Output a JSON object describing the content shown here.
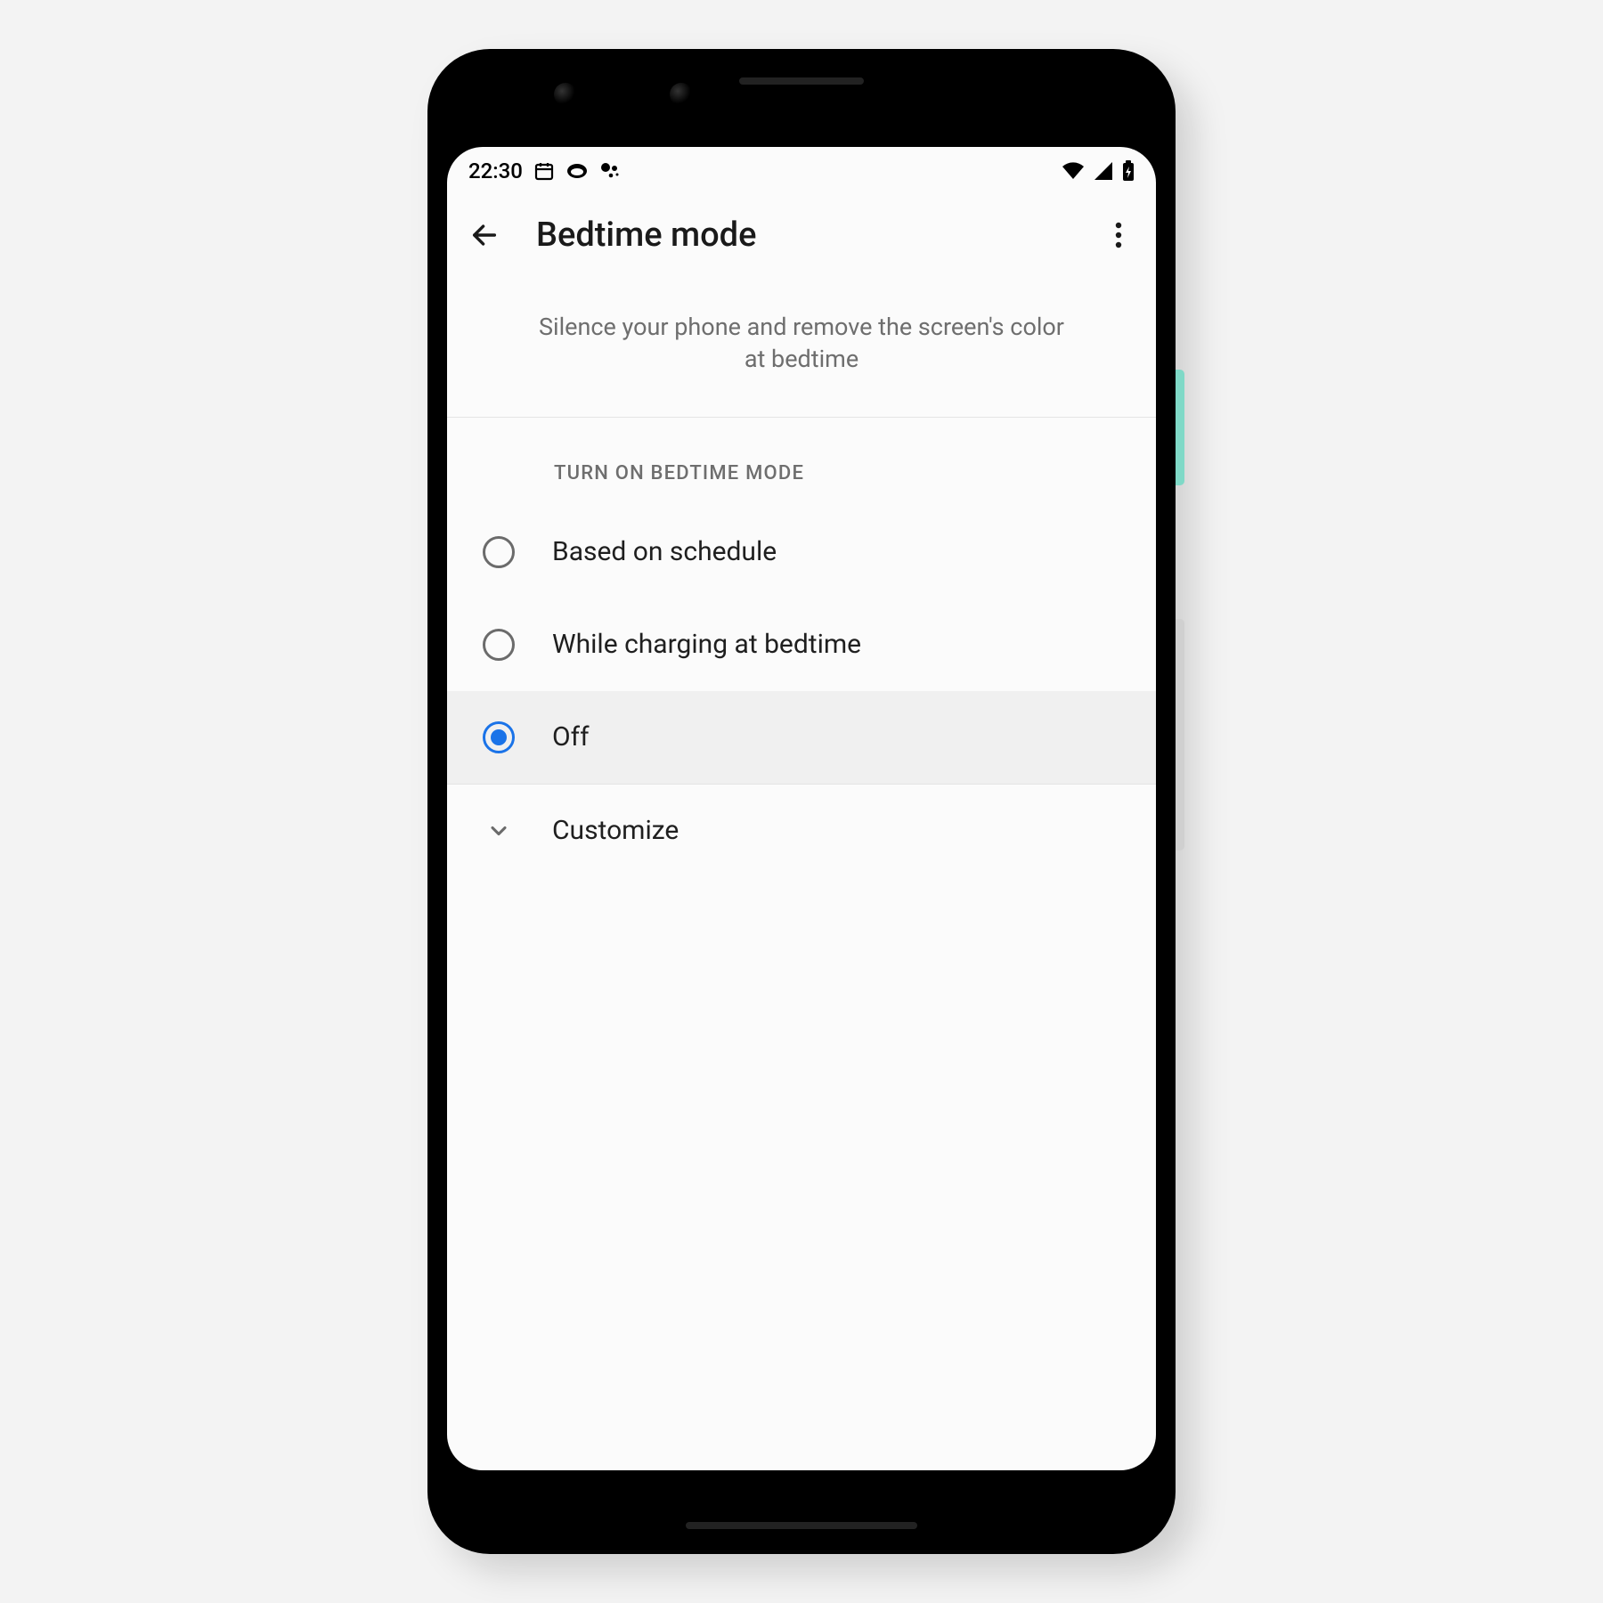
{
  "status_bar": {
    "time": "22:30"
  },
  "app_bar": {
    "title": "Bedtime mode"
  },
  "description": "Silence your phone and remove the screen's color at bedtime",
  "section_header": "TURN ON BEDTIME MODE",
  "options": [
    {
      "label": "Based on schedule",
      "selected": false
    },
    {
      "label": "While charging at bedtime",
      "selected": false
    },
    {
      "label": "Off",
      "selected": true
    }
  ],
  "expand": {
    "label": "Customize"
  },
  "colors": {
    "accent": "#1a73e8"
  }
}
